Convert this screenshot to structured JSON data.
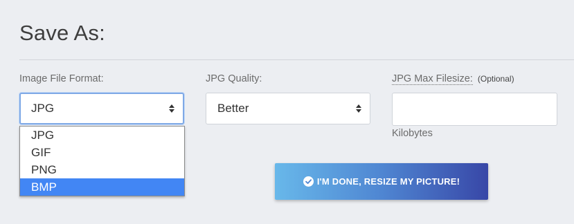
{
  "section": {
    "title": "Save As:"
  },
  "format": {
    "label": "Image File Format:",
    "selected": "JPG",
    "options": [
      "JPG",
      "GIF",
      "PNG",
      "BMP"
    ],
    "highlighted": "BMP"
  },
  "quality": {
    "label": "JPG Quality:",
    "selected": "Better"
  },
  "max_filesize": {
    "label": "JPG Max Filesize:",
    "optional": "(Optional)",
    "value": "",
    "unit_hint": "Kilobytes"
  },
  "submit": {
    "label": "I'M DONE, RESIZE MY PICTURE!",
    "icon": "check-circle-icon"
  },
  "colors": {
    "highlight": "#4286f4",
    "button_gradient_start": "#68b8ea",
    "button_gradient_end": "#3847a7",
    "focus_border": "#7fa9e6"
  }
}
